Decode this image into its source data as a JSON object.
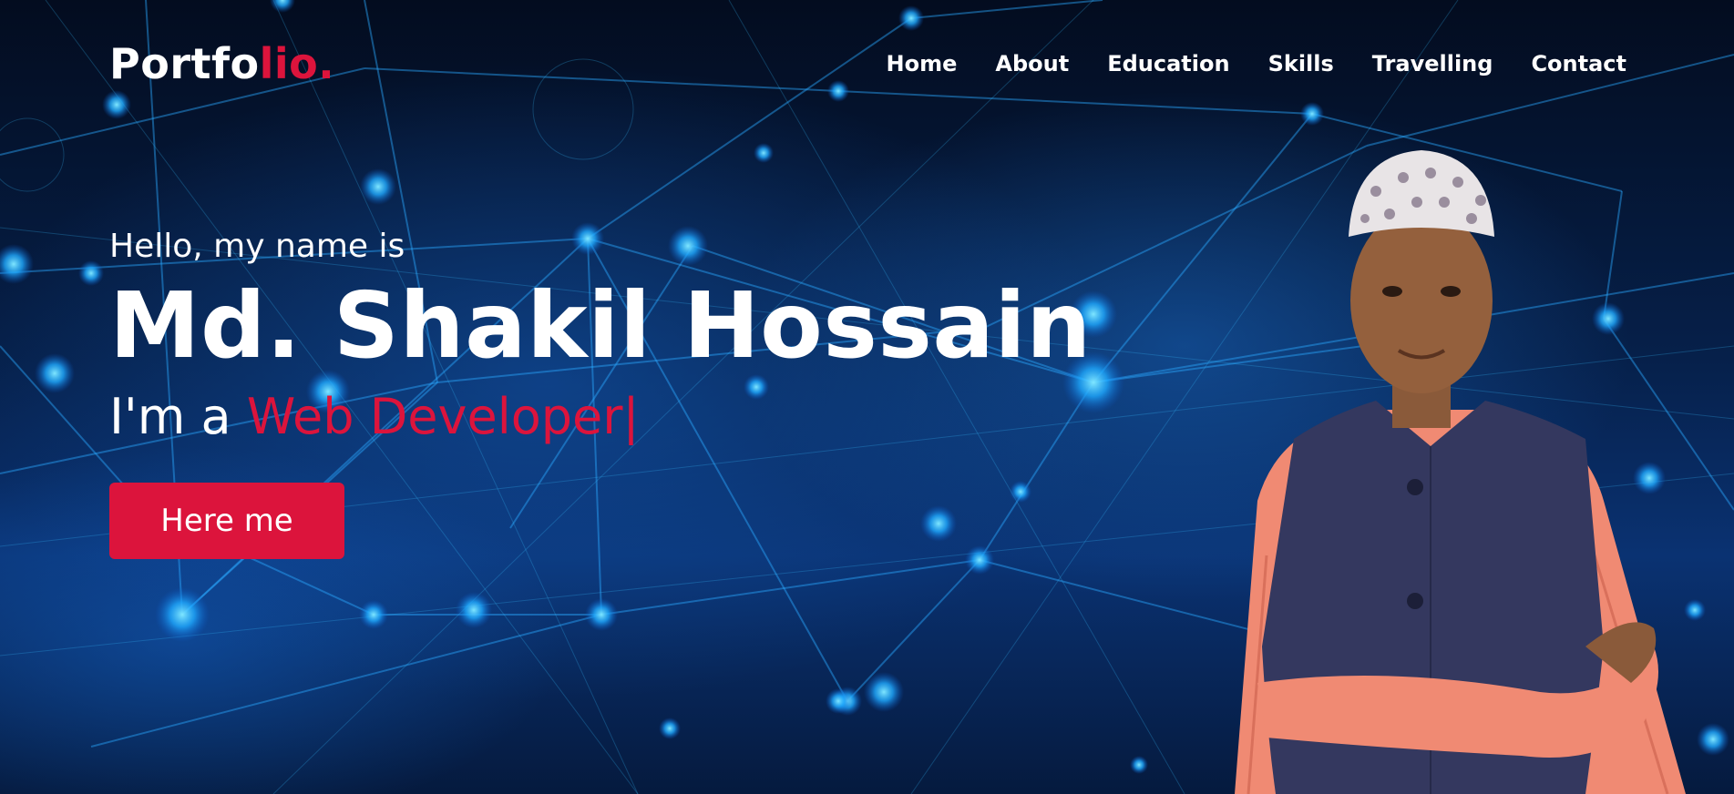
{
  "nav": {
    "logo_main": "Portfo",
    "logo_accent": "lio.",
    "items": [
      {
        "label": "Home"
      },
      {
        "label": "About"
      },
      {
        "label": "Education"
      },
      {
        "label": "Skills"
      },
      {
        "label": "Travelling"
      },
      {
        "label": "Contact"
      }
    ]
  },
  "hero": {
    "greeting": "Hello, my name is",
    "name": "Md. Shakil Hossain",
    "role_prefix": "I'm a",
    "role_typed": "Web Developer|",
    "button_label": "Here me"
  },
  "colors": {
    "accent": "#dc143c",
    "text": "#ffffff",
    "background": "#041024"
  }
}
